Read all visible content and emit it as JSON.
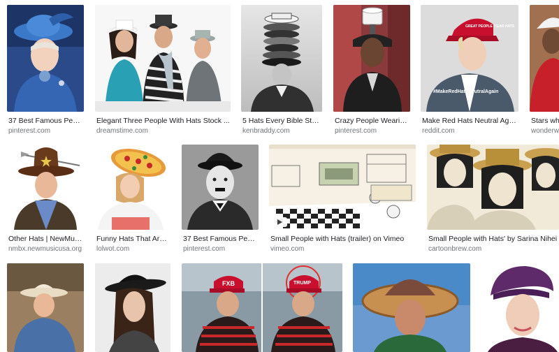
{
  "results": [
    {
      "title": "37 Best Famous Peopl...",
      "source": "pinterest.com"
    },
    {
      "title": "Elegant Three People With Hats Stock ...",
      "source": "dreamstime.com"
    },
    {
      "title": "5 Hats Every Bible Study ...",
      "source": "kenbraddy.com"
    },
    {
      "title": "Crazy People Wearing ...",
      "source": "pinterest.com"
    },
    {
      "title": "Make Red Hats Neutral Again :...",
      "source": "reddit.com"
    },
    {
      "title": "Stars who...",
      "source": "wonderwa..."
    },
    {
      "title": "Other Hats | NewMusic...",
      "source": "nmbx.newmusicusa.org"
    },
    {
      "title": "Funny Hats That Are S...",
      "source": "lolwot.com"
    },
    {
      "title": "37 Best Famous Peopl...",
      "source": "pinterest.com"
    },
    {
      "title": "Small People with Hats (trailer) on Vimeo",
      "source": "vimeo.com"
    },
    {
      "title": "Small People with Hats' by Sarina Nihei",
      "source": "cartoonbrew.com"
    }
  ],
  "image_texts": {
    "red_hat_caption": "#MakeRedHatsNeutralAgain",
    "red_hat_cap_text": "GREAT PEOPLE WEAR HATS",
    "fxb_cap": "FXB",
    "trump_cap": "TRUMP"
  },
  "icons": {
    "video_badge": "play-icon"
  },
  "colors": {
    "title_text": "#202124",
    "source_text": "#70757a",
    "background": "#ffffff"
  }
}
